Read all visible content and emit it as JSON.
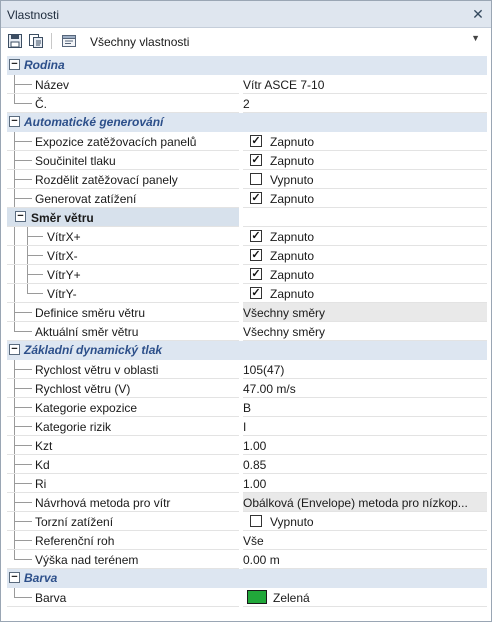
{
  "panel_title": "Vlastnosti",
  "close_glyph": "✕",
  "toolbar": {
    "filter_value": "Všechny vlastnosti",
    "icons": [
      "save-icon",
      "copy-properties-icon",
      "properties-icon"
    ]
  },
  "categories": {
    "rodina": "Rodina",
    "auto": "Automatické generování",
    "dyn": "Základní dynamický tlak",
    "barva": "Barva"
  },
  "rodina": {
    "nazev_label": "Název",
    "nazev_value": "Vítr ASCE 7-10",
    "c_label": "Č.",
    "c_value": "2"
  },
  "auto": {
    "expozice_label": "Expozice zatěžovacích panelů",
    "expozice_value": "Zapnuto",
    "soucinitel_label": "Součinitel tlaku",
    "soucinitel_value": "Zapnuto",
    "rozdelit_label": "Rozdělit zatěžovací panely",
    "rozdelit_value": "Vypnuto",
    "generovat_label": "Generovat zatížení",
    "generovat_value": "Zapnuto",
    "smer_label": "Směr větru",
    "vxp_label": "VítrX+",
    "vxp_value": "Zapnuto",
    "vxm_label": "VítrX-",
    "vxm_value": "Zapnuto",
    "vyp_label": "VítrY+",
    "vyp_value": "Zapnuto",
    "vym_label": "VítrY-",
    "vym_value": "Zapnuto",
    "definice_label": "Definice směru větru",
    "definice_value": "Všechny směry",
    "aktualni_label": "Aktuální směr větru",
    "aktualni_value": "Všechny směry"
  },
  "dyn": {
    "rychlost_obl_label": "Rychlost větru v oblasti",
    "rychlost_obl_value": "105(47)",
    "rychlost_label": "Rychlost větru (V)",
    "rychlost_value": "47.00 m/s",
    "kat_exp_label": "Kategorie expozice",
    "kat_exp_value": "B",
    "kat_riz_label": "Kategorie rizik",
    "kat_riz_value": "I",
    "kzt_label": "Kzt",
    "kzt_value": "1.00",
    "kd_label": "Kd",
    "kd_value": "0.85",
    "ri_label": "Ri",
    "ri_value": "1.00",
    "metoda_label": "Návrhová metoda pro vítr",
    "metoda_value": "Obálková (Envelope) metoda pro nízkop...",
    "torzni_label": "Torzní zatížení",
    "torzni_value": "Vypnuto",
    "roh_label": "Referenční roh",
    "roh_value": "Vše",
    "vyska_label": "Výška nad terénem",
    "vyska_value": "0.00 m"
  },
  "barva": {
    "label": "Barva",
    "value": "Zelená",
    "swatch_color": "#21a83a"
  },
  "checked": {
    "expozice": true,
    "soucinitel": true,
    "rozdelit": false,
    "generovat": true,
    "vxp": true,
    "vxm": true,
    "vyp": true,
    "vym": true,
    "torzni": false
  }
}
